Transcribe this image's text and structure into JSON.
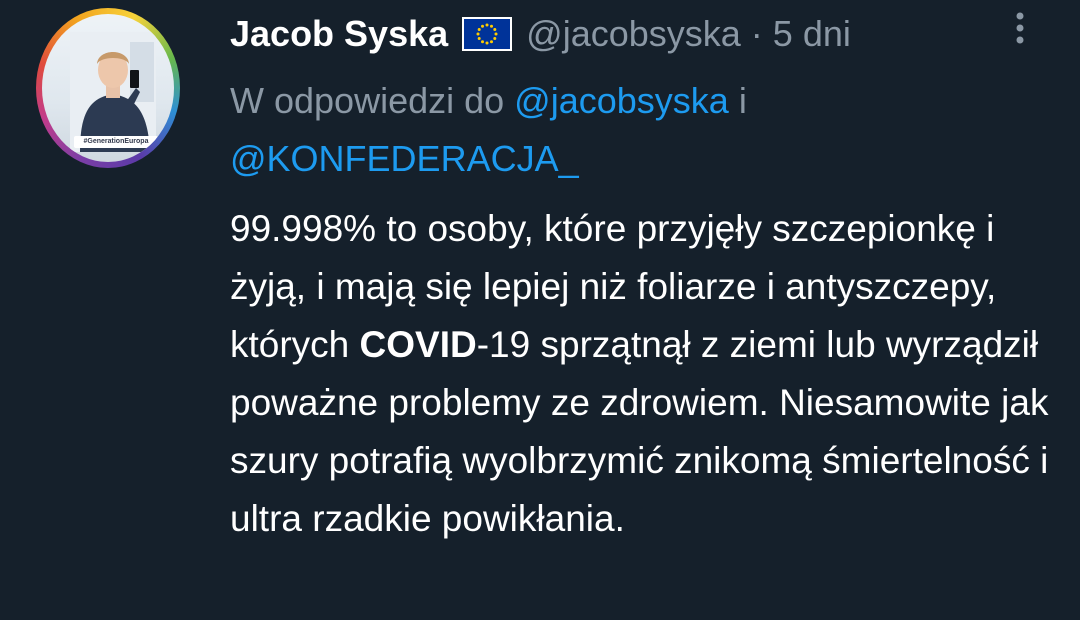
{
  "author": {
    "name": "Jacob Syska",
    "handle": "@jacobsyska",
    "separator": "·",
    "time": "5 dni",
    "avatar_tag": "#GenerationEuropa",
    "badge_icon": "eu-flag-icon"
  },
  "reply": {
    "prefix": "W odpowiedzi do",
    "mention_1": "@jacobsyska",
    "conjunction": "i",
    "mention_2": "@KONFEDERACJA_"
  },
  "tweet": {
    "segment_1": "99.998% to osoby, które przyjęły szczepionkę i żyją, i mają się lepiej niż foliarze i antyszczepy, których ",
    "bold_term": "COVID",
    "segment_2": "-19 sprzątnął z ziemi lub wyrządził poważne problemy ze zdrowiem. Niesamowite jak szury potrafią wyolbrzymić znikomą śmiertelność i ultra rzadkie powikłania."
  },
  "menu": {
    "icon": "more-options-icon"
  },
  "colors": {
    "background": "#15202b",
    "text": "#ffffff",
    "secondary": "#8b98a5",
    "link": "#1d9bf0",
    "eu_blue": "#003399",
    "eu_star": "#ffcc00"
  }
}
